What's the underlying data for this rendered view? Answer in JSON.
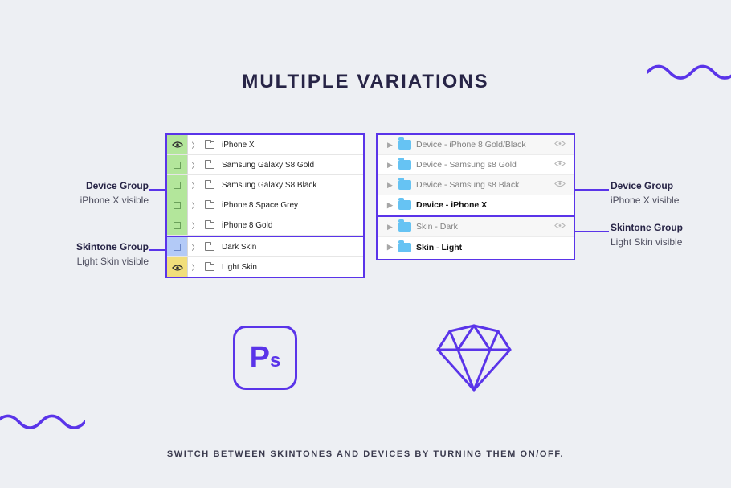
{
  "title": "MULTIPLE VARIATIONS",
  "footer": "SWITCH BETWEEN SKINTONES AND DEVICES BY TURNING THEM ON/OFF.",
  "callouts": {
    "deviceLeft": {
      "title": "Device Group",
      "sub": "iPhone X visible"
    },
    "skinLeft": {
      "title": "Skintone Group",
      "sub": "Light Skin visible"
    },
    "deviceRight": {
      "title": "Device Group",
      "sub": "iPhone X visible"
    },
    "skinRight": {
      "title": "Skintone Group",
      "sub": "Light Skin visible"
    }
  },
  "photoshop": {
    "devices": [
      {
        "name": "iPhone X",
        "visible": true
      },
      {
        "name": "Samsung Galaxy S8 Gold",
        "visible": false
      },
      {
        "name": "Samsung Galaxy S8 Black",
        "visible": false
      },
      {
        "name": "iPhone 8 Space Grey",
        "visible": false
      },
      {
        "name": "iPhone 8 Gold",
        "visible": false
      }
    ],
    "skins": [
      {
        "name": "Dark Skin",
        "visible": false,
        "color": "blue"
      },
      {
        "name": "Light Skin",
        "visible": true,
        "color": "yellow"
      }
    ]
  },
  "sketch": {
    "devices": [
      {
        "name": "Device - iPhone 8 Gold/Black",
        "active": false,
        "eye": true
      },
      {
        "name": "Device - Samsung s8 Gold",
        "active": false,
        "eye": true
      },
      {
        "name": "Device - Samsung s8 Black",
        "active": false,
        "eye": true
      },
      {
        "name": "Device - iPhone X",
        "active": true,
        "eye": false
      }
    ],
    "skins": [
      {
        "name": "Skin - Dark",
        "active": false,
        "eye": true
      },
      {
        "name": "Skin - Light",
        "active": true,
        "eye": false
      }
    ]
  },
  "apps": {
    "ps": "Ps"
  }
}
